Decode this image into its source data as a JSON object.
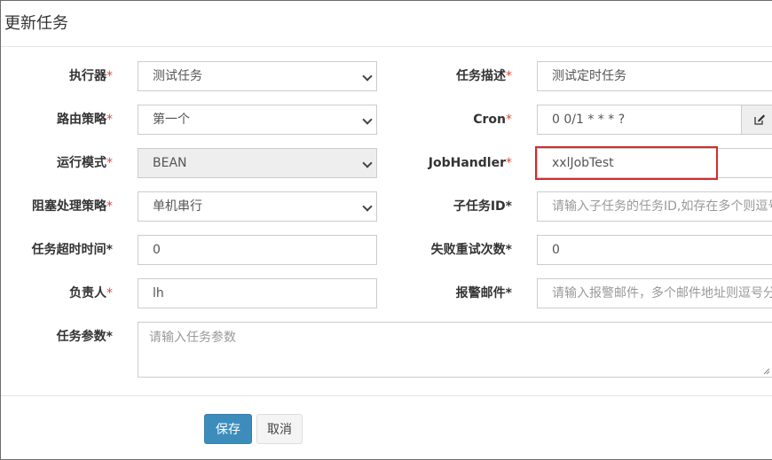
{
  "modal": {
    "title": "更新任务"
  },
  "form": {
    "executor": {
      "label": "执行器",
      "value": "测试任务"
    },
    "job_desc": {
      "label": "任务描述",
      "value": "测试定时任务"
    },
    "route_strategy": {
      "label": "路由策略",
      "value": "第一个"
    },
    "cron": {
      "label": "Cron",
      "value": "0 0/1 * * * ?"
    },
    "run_mode": {
      "label": "运行模式",
      "value": "BEAN"
    },
    "job_handler": {
      "label": "JobHandler",
      "value": "xxlJobTest"
    },
    "block_strategy": {
      "label": "阻塞处理策略",
      "value": "单机串行"
    },
    "child_job_id": {
      "label": "子任务ID",
      "placeholder": "请输入子任务的任务ID,如存在多个则逗号分隔"
    },
    "timeout": {
      "label": "任务超时时间",
      "value": "0"
    },
    "fail_retry": {
      "label": "失败重试次数",
      "value": "0"
    },
    "author": {
      "label": "负责人",
      "value": "lh"
    },
    "alarm_email": {
      "label": "报警邮件",
      "placeholder": "请输入报警邮件，多个邮件地址则逗号分隔"
    },
    "job_param": {
      "label": "任务参数",
      "placeholder": "请输入任务参数"
    },
    "required_mark": "*"
  },
  "buttons": {
    "save": "保存",
    "cancel": "取消"
  },
  "colors": {
    "primary": "#3c8dbc",
    "required": "#dd4b39",
    "highlight": "#d62b2b"
  }
}
